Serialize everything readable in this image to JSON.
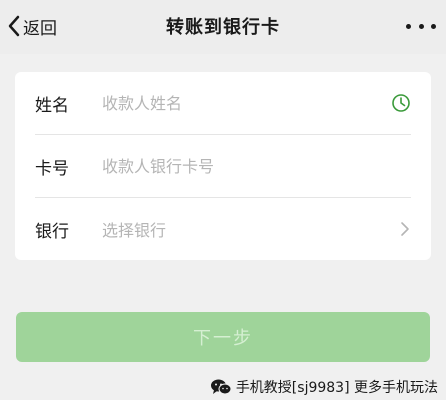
{
  "header": {
    "back_label": "返回",
    "title": "转账到银行卡"
  },
  "form": {
    "name": {
      "label": "姓名",
      "placeholder": "收款人姓名",
      "value": ""
    },
    "card": {
      "label": "卡号",
      "placeholder": "收款人银行卡号",
      "value": ""
    },
    "bank": {
      "label": "银行",
      "value": "选择银行"
    }
  },
  "next_button": {
    "label": "下一步"
  },
  "watermark": {
    "text": "手机教授[sj9983] 更多手机玩法"
  },
  "colors": {
    "accent_green": "#3a9a3a",
    "button_disabled_bg": "#9fd49a",
    "button_disabled_text": "#d5efd2",
    "page_bg": "#f0f0f0"
  },
  "icons": {
    "back": "chevron-left-icon",
    "more": "more-dots-icon",
    "contact": "clock-icon",
    "bank_arrow": "chevron-right-icon",
    "watermark": "wechat-logo-icon"
  }
}
